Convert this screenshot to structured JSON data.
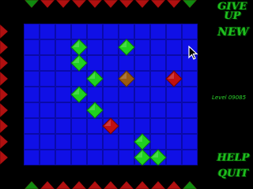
{
  "sidebar": {
    "give_up_label": "GIVE UP",
    "new_label": "NEW",
    "level_label": "Level 09085",
    "help_label": "HELP",
    "quit_label": "QUIT"
  },
  "board": {
    "cols": 11,
    "rows": 9,
    "cell_color": "#1010e6",
    "grid_line_color": "#0a0aa8",
    "pieces": [
      {
        "col": 3,
        "row": 1,
        "kind": "green"
      },
      {
        "col": 6,
        "row": 1,
        "kind": "green"
      },
      {
        "col": 3,
        "row": 2,
        "kind": "green"
      },
      {
        "col": 4,
        "row": 3,
        "kind": "green"
      },
      {
        "col": 6,
        "row": 3,
        "kind": "brown"
      },
      {
        "col": 9,
        "row": 3,
        "kind": "red"
      },
      {
        "col": 3,
        "row": 4,
        "kind": "green"
      },
      {
        "col": 4,
        "row": 5,
        "kind": "green"
      },
      {
        "col": 5,
        "row": 6,
        "kind": "red"
      },
      {
        "col": 7,
        "row": 7,
        "kind": "green"
      },
      {
        "col": 7,
        "row": 8,
        "kind": "green"
      },
      {
        "col": 8,
        "row": 8,
        "kind": "green"
      }
    ]
  },
  "colors": {
    "green": "#1fd21f",
    "green_dark": "#0a7a0a",
    "red": "#c01010",
    "red_dark": "#6a0505",
    "brown": "#9a5a10",
    "brown_dark": "#5a3008",
    "border_red": "#b01010",
    "border_green": "#0f8a0f"
  },
  "icons": {
    "cursor": "arrow-cursor-icon"
  }
}
